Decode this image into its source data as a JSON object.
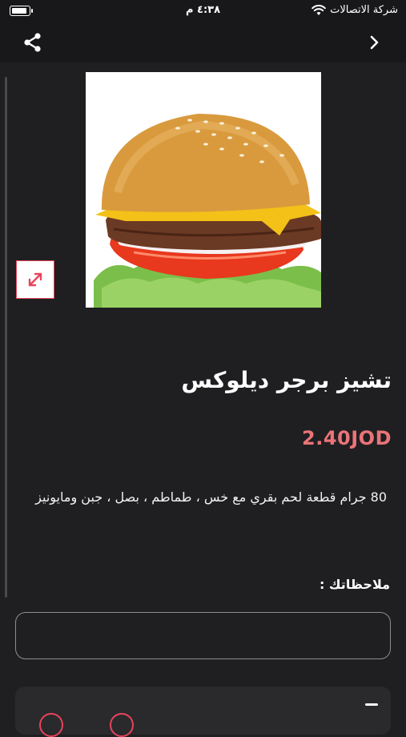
{
  "status_bar": {
    "carrier": "شركة الاتصالات",
    "time": "٤:٣٨ م"
  },
  "icons": {
    "share": "share-icon",
    "back": "chevron-right-icon",
    "expand": "expand-arrows-icon",
    "wifi": "wifi-icon",
    "battery": "battery-icon"
  },
  "product": {
    "title": "تشيز برجر ديلوكس",
    "price": "2.40JOD",
    "description": "80 جرام قطعة لحم بقري مع خس ، طماطم ، بصل ، جبن ومايونيز"
  },
  "notes": {
    "label": "ملاحظاتك :",
    "value": ""
  },
  "colors": {
    "background": "#1f1f21",
    "accent": "#e8445a",
    "price": "#e97478"
  }
}
